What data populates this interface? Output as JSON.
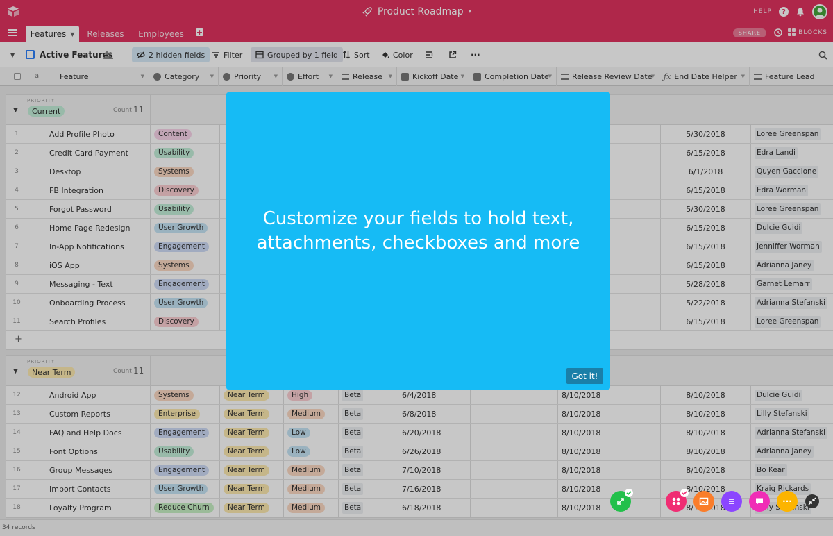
{
  "app": {
    "title": "Product Roadmap"
  },
  "topbar": {
    "help_label": "HELP"
  },
  "tabs": [
    {
      "label": "Features"
    },
    {
      "label": "Releases"
    },
    {
      "label": "Employees"
    }
  ],
  "tabbar": {
    "share_label": "SHARE",
    "blocks_label": "BLOCKS"
  },
  "view": {
    "name": "Active Features",
    "hidden_fields": "2 hidden fields",
    "filter": "Filter",
    "grouped": "Grouped by 1 field",
    "sort": "Sort",
    "color": "Color"
  },
  "columns": {
    "feature": "Feature",
    "category": "Category",
    "priority": "Priority",
    "effort": "Effort",
    "release": "Release",
    "kickoff": "Kickoff Date",
    "completion": "Completion Date",
    "review": "Release Review Date",
    "end_helper": "End Date Helper",
    "lead": "Feature Lead"
  },
  "colors": {
    "topbar": "#e0335f",
    "modal": "#16bbf5",
    "got_it": "#1a7fa8",
    "cat_content": "#f9d4ea",
    "cat_usability": "#c3efd9",
    "cat_systems": "#fcd9c3",
    "cat_discovery": "#fccfd3",
    "cat_user_growth": "#c6e5f5",
    "cat_engagement": "#cfdcf7",
    "cat_enterprise": "#fde9b0",
    "cat_reduce_churn": "#c7f0c4"
  },
  "groups": [
    {
      "label": "PRIORITY",
      "name": "Current",
      "pill_color": "#c3efd9",
      "count_label": "Count",
      "count": "11",
      "rows": [
        {
          "n": "1",
          "feature": "Add Profile Photo",
          "category": "Content",
          "cat_color": "#f9d4ea",
          "end": "5/30/2018",
          "lead": "Loree Greenspan"
        },
        {
          "n": "2",
          "feature": "Credit Card Payment",
          "category": "Usability",
          "cat_color": "#c3efd9",
          "end": "6/15/2018",
          "lead": "Edra Landi"
        },
        {
          "n": "3",
          "feature": "Desktop",
          "category": "Systems",
          "cat_color": "#fcd9c3",
          "end": "6/1/2018",
          "lead": "Quyen Gaccione"
        },
        {
          "n": "4",
          "feature": "FB Integration",
          "category": "Discovery",
          "cat_color": "#fccfd3",
          "end": "6/15/2018",
          "lead": "Edra Worman"
        },
        {
          "n": "5",
          "feature": "Forgot Password",
          "category": "Usability",
          "cat_color": "#c3efd9",
          "end": "5/30/2018",
          "lead": "Loree Greenspan"
        },
        {
          "n": "6",
          "feature": "Home Page Redesign",
          "category": "User Growth",
          "cat_color": "#c6e5f5",
          "end": "6/15/2018",
          "lead": "Dulcie Guidi"
        },
        {
          "n": "7",
          "feature": "In-App Notifications",
          "category": "Engagement",
          "cat_color": "#cfdcf7",
          "end": "6/15/2018",
          "lead": "Jenniffer Worman"
        },
        {
          "n": "8",
          "feature": "iOS App",
          "category": "Systems",
          "cat_color": "#fcd9c3",
          "end": "6/15/2018",
          "lead": "Adrianna Janey"
        },
        {
          "n": "9",
          "feature": "Messaging - Text",
          "category": "Engagement",
          "cat_color": "#cfdcf7",
          "end": "5/28/2018",
          "lead": "Garnet Lemarr"
        },
        {
          "n": "10",
          "feature": "Onboarding Process",
          "category": "User Growth",
          "cat_color": "#c6e5f5",
          "end": "5/22/2018",
          "lead": "Adrianna Stefanski"
        },
        {
          "n": "11",
          "feature": "Search Profiles",
          "category": "Discovery",
          "cat_color": "#fccfd3",
          "end": "6/15/2018",
          "lead": "Loree Greenspan"
        }
      ]
    },
    {
      "label": "PRIORITY",
      "name": "Near Term",
      "pill_color": "#fde9b0",
      "count_label": "Count",
      "count": "11",
      "rows": [
        {
          "n": "12",
          "feature": "Android App",
          "category": "Systems",
          "cat_color": "#fcd9c3",
          "priority": "Near Term",
          "effort": "High",
          "effort_color": "#fccfd3",
          "release": "Beta",
          "kickoff": "6/4/2018",
          "review": "8/10/2018",
          "end": "8/10/2018",
          "lead": "Dulcie Guidi"
        },
        {
          "n": "13",
          "feature": "Custom Reports",
          "category": "Enterprise",
          "cat_color": "#fde9b0",
          "priority": "Near Term",
          "effort": "Medium",
          "effort_color": "#fcd9c3",
          "release": "Beta",
          "kickoff": "6/8/2018",
          "review": "8/10/2018",
          "end": "8/10/2018",
          "lead": "Lilly Stefanski"
        },
        {
          "n": "14",
          "feature": "FAQ and Help Docs",
          "category": "Engagement",
          "cat_color": "#cfdcf7",
          "priority": "Near Term",
          "effort": "Low",
          "effort_color": "#c6e5f5",
          "release": "Beta",
          "kickoff": "6/20/2018",
          "review": "8/10/2018",
          "end": "8/10/2018",
          "lead": "Adrianna Stefanski"
        },
        {
          "n": "15",
          "feature": "Font Options",
          "category": "Usability",
          "cat_color": "#c3efd9",
          "priority": "Near Term",
          "effort": "Low",
          "effort_color": "#c6e5f5",
          "release": "Beta",
          "kickoff": "6/26/2018",
          "review": "8/10/2018",
          "end": "8/10/2018",
          "lead": "Adrianna Janey"
        },
        {
          "n": "16",
          "feature": "Group Messages",
          "category": "Engagement",
          "cat_color": "#cfdcf7",
          "priority": "Near Term",
          "effort": "Medium",
          "effort_color": "#fcd9c3",
          "release": "Beta",
          "kickoff": "7/10/2018",
          "review": "8/10/2018",
          "end": "8/10/2018",
          "lead": "Bo Kear"
        },
        {
          "n": "17",
          "feature": "Import Contacts",
          "category": "User Growth",
          "cat_color": "#c6e5f5",
          "priority": "Near Term",
          "effort": "Medium",
          "effort_color": "#fcd9c3",
          "release": "Beta",
          "kickoff": "7/16/2018",
          "review": "8/10/2018",
          "end": "8/10/2018",
          "lead": "Kraig Rickards"
        },
        {
          "n": "18",
          "feature": "Loyalty Program",
          "category": "Reduce Churn",
          "cat_color": "#c7f0c4",
          "priority": "Near Term",
          "effort": "Medium",
          "effort_color": "#fcd9c3",
          "release": "Beta",
          "kickoff": "6/18/2018",
          "review": "8/10/2018",
          "end": "8/10/2018",
          "lead": "Tony Stefanski"
        }
      ]
    }
  ],
  "footer": {
    "records": "34 records"
  },
  "modal": {
    "line1": "Customize your fields to hold text,",
    "line2": "attachments, checkboxes and more",
    "button": "Got it!"
  },
  "bubbles": [
    {
      "name": "expand-bubble",
      "color": "#22c04a"
    },
    {
      "name": "apps-bubble",
      "color": "#f02d73"
    },
    {
      "name": "image-bubble",
      "color": "#fa7d2a"
    },
    {
      "name": "list-bubble",
      "color": "#8b46ff"
    },
    {
      "name": "chat-bubble",
      "color": "#f02db6"
    },
    {
      "name": "more-bubble",
      "color": "#fcb400"
    }
  ]
}
